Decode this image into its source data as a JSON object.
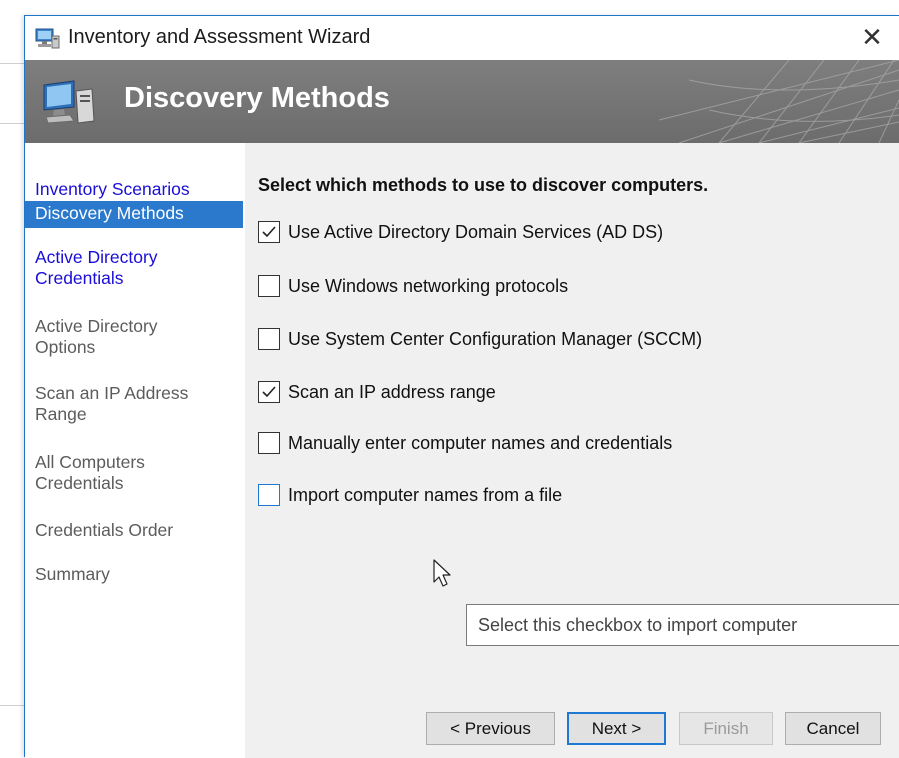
{
  "window": {
    "title": "Inventory and Assessment Wizard",
    "close_icon": "close-icon",
    "app_icon": "wizard-app-icon"
  },
  "banner": {
    "title": "Discovery Methods",
    "icon": "computer-monitor-icon"
  },
  "nav": {
    "items": [
      {
        "label": "Inventory Scenarios",
        "state": "link"
      },
      {
        "label": "Discovery Methods",
        "state": "active"
      },
      {
        "label": "Active Directory Credentials",
        "state": "link"
      },
      {
        "label": "Active Directory Options",
        "state": "muted"
      },
      {
        "label": "Scan an IP Address Range",
        "state": "muted"
      },
      {
        "label": "All Computers Credentials",
        "state": "muted"
      },
      {
        "label": "Credentials Order",
        "state": "muted"
      },
      {
        "label": "Summary",
        "state": "muted"
      }
    ]
  },
  "content": {
    "heading": "Select which methods to use to discover computers.",
    "options": [
      {
        "label": "Use Active Directory Domain Services (AD DS)",
        "checked": true
      },
      {
        "label": "Use Windows networking protocols",
        "checked": false
      },
      {
        "label": "Use System Center Configuration Manager (SCCM)",
        "checked": false
      },
      {
        "label": "Scan an IP address range",
        "checked": true
      },
      {
        "label": "Manually enter computer names and credentials",
        "checked": false
      },
      {
        "label": "Import computer names from a file",
        "checked": false,
        "hovered": true
      }
    ],
    "tooltip": "Select this checkbox to import computer"
  },
  "buttons": {
    "previous": "< Previous",
    "next": "Next >",
    "finish": "Finish",
    "cancel": "Cancel"
  },
  "colors": {
    "accent": "#1e78d4",
    "nav_active_bg": "#2b79cc",
    "link": "#1a0dd8",
    "banner_bg": "#747474",
    "content_bg": "#f0f0f0"
  }
}
